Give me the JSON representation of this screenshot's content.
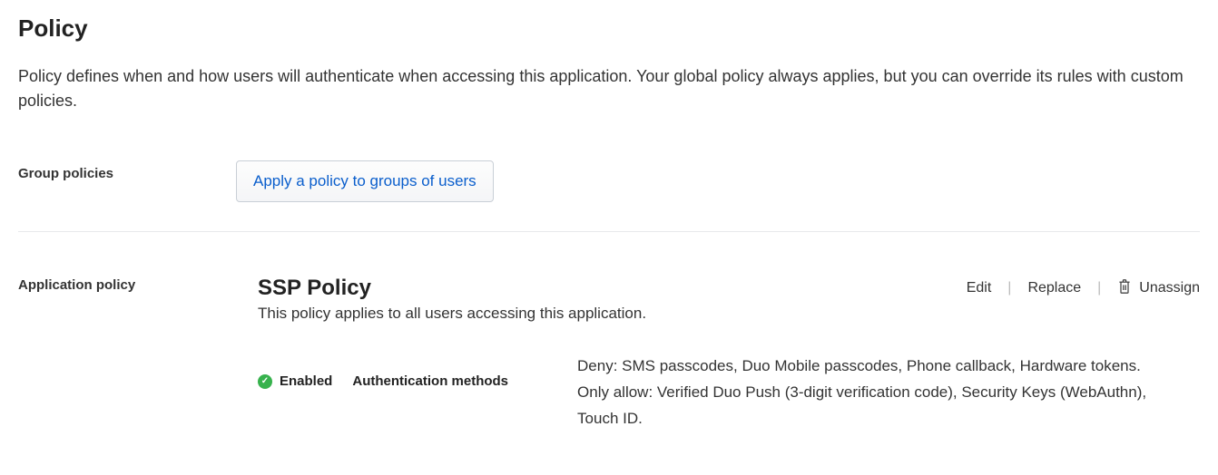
{
  "header": {
    "title": "Policy",
    "description": "Policy defines when and how users will authenticate when accessing this application. Your global policy always applies, but you can override its rules with custom policies."
  },
  "group_policies": {
    "label": "Group policies",
    "apply_button": "Apply a policy to groups of users"
  },
  "application_policy": {
    "label": "Application policy",
    "name": "SSP Policy",
    "subtitle": "This policy applies to all users accessing this application.",
    "actions": {
      "edit": "Edit",
      "replace": "Replace",
      "unassign": "Unassign"
    },
    "status": {
      "text": "Enabled"
    },
    "auth_methods": {
      "label": "Authentication methods",
      "description": "Deny: SMS passcodes, Duo Mobile passcodes, Phone callback, Hardware tokens. Only allow: Verified Duo Push (3-digit verification code), Security Keys (WebAuthn), Touch ID."
    }
  }
}
